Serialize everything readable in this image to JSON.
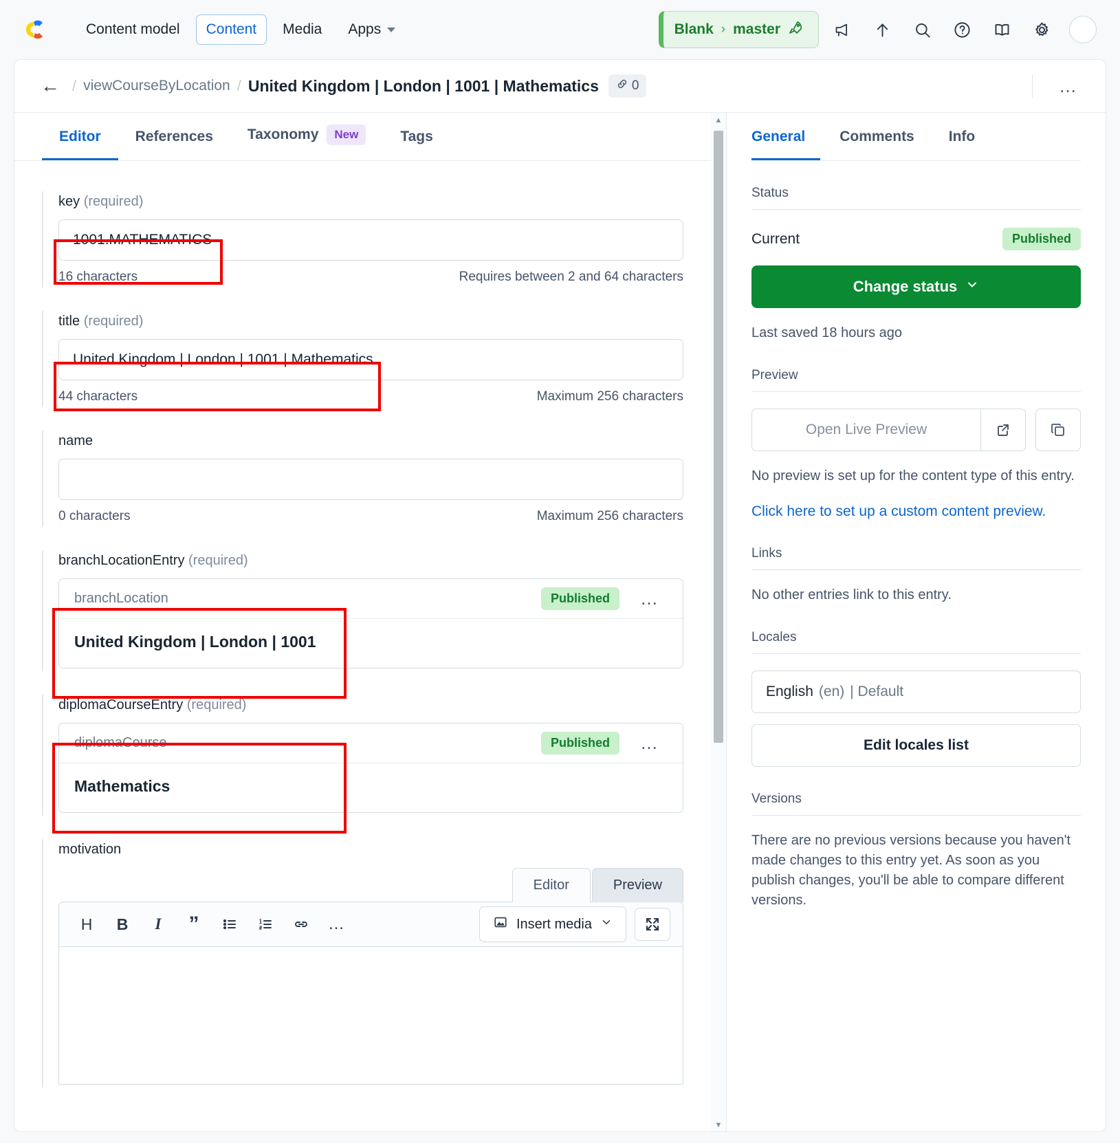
{
  "topnav": {
    "logo_icon": "contentful-logo",
    "items": [
      {
        "label": "Content model",
        "active": false,
        "caret": false
      },
      {
        "label": "Content",
        "active": true,
        "caret": false
      },
      {
        "label": "Media",
        "active": false,
        "caret": false
      },
      {
        "label": "Apps",
        "active": false,
        "caret": true
      }
    ],
    "environment": {
      "space": "Blank",
      "separator": "›",
      "env": "master",
      "icon": "rocket-icon"
    },
    "icons": [
      "megaphone-icon",
      "arrow-up-icon",
      "search-icon",
      "help-circle-icon",
      "book-icon",
      "gear-icon"
    ],
    "avatar": "user-avatar"
  },
  "breadcrumb": {
    "back_icon": "back-arrow-icon",
    "separator": "/",
    "parent": "viewCourseByLocation",
    "title": "United Kingdom | London | 1001 | Mathematics",
    "link_icon": "link-icon",
    "link_count": "0",
    "more_icon": "…"
  },
  "editor_tabs": [
    {
      "label": "Editor",
      "active": true,
      "badge": null
    },
    {
      "label": "References",
      "active": false,
      "badge": null
    },
    {
      "label": "Taxonomy",
      "active": false,
      "badge": "New"
    },
    {
      "label": "Tags",
      "active": false,
      "badge": null
    }
  ],
  "fields": {
    "key": {
      "label": "key",
      "required_text": "(required)",
      "value": "1001.MATHEMATICS",
      "count": "16 characters",
      "hint": "Requires between 2 and 64 characters"
    },
    "title": {
      "label": "title",
      "required_text": "(required)",
      "value": "United Kingdom | London | 1001 | Mathematics",
      "count": "44 characters",
      "hint": "Maximum 256 characters"
    },
    "name": {
      "label": "name",
      "required_text": "",
      "value": "",
      "count": "0 characters",
      "hint": "Maximum 256 characters"
    },
    "branchLocationEntry": {
      "label": "branchLocationEntry",
      "required_text": "(required)",
      "ref_type": "branchLocation",
      "status": "Published",
      "ref_title": "United Kingdom | London | 1001",
      "more_icon": "…"
    },
    "diplomaCourseEntry": {
      "label": "diplomaCourseEntry",
      "required_text": "(required)",
      "ref_type": "diplomaCourse",
      "status": "Published",
      "ref_title": "Mathematics",
      "more_icon": "…"
    },
    "motivation": {
      "label": "motivation",
      "mode_tabs": [
        {
          "label": "Editor",
          "active": false
        },
        {
          "label": "Preview",
          "active": true
        }
      ],
      "toolbar": [
        {
          "icon": "heading-icon",
          "glyph": "H"
        },
        {
          "icon": "bold-icon",
          "glyph": "B"
        },
        {
          "icon": "italic-icon",
          "glyph": "I"
        },
        {
          "icon": "quote-icon",
          "glyph": "”"
        },
        {
          "icon": "bullet-list-icon",
          "glyph": ""
        },
        {
          "icon": "numbered-list-icon",
          "glyph": ""
        },
        {
          "icon": "link-icon",
          "glyph": ""
        },
        {
          "icon": "more-options-icon",
          "glyph": "…"
        }
      ],
      "insert_media_label": "Insert media",
      "insert_media_icon": "image-icon",
      "expand_icon": "expand-icon",
      "content": ""
    }
  },
  "sidebar": {
    "tabs": [
      {
        "label": "General",
        "active": true
      },
      {
        "label": "Comments",
        "active": false
      },
      {
        "label": "Info",
        "active": false
      }
    ],
    "status": {
      "heading": "Status",
      "current_label": "Current",
      "current_value": "Published",
      "change_button": "Change status",
      "change_caret": "chevron-down-icon",
      "last_saved": "Last saved 18 hours ago"
    },
    "preview": {
      "heading": "Preview",
      "open_label": "Open Live Preview",
      "external_icon": "external-link-icon",
      "copy_icon": "copy-icon",
      "note": "No preview is set up for the content type of this entry.",
      "setup_link": "Click here to set up a custom content preview."
    },
    "links": {
      "heading": "Links",
      "note": "No other entries link to this entry."
    },
    "locales": {
      "heading": "Locales",
      "current": "English",
      "code": "(en)",
      "default_label": "| Default",
      "edit_button": "Edit locales list"
    },
    "versions": {
      "heading": "Versions",
      "note": "There are no previous versions because you haven't made changes to this entry yet. As soon as you publish changes, you'll be able to compare different versions."
    }
  },
  "colors": {
    "accent_blue": "#0d66d0",
    "publish_green": "#0a8a33",
    "badge_green_bg": "#c8f0cb",
    "badge_green_text": "#137d2e",
    "badge_new_bg": "#f0e6fb",
    "badge_new_text": "#7c3fce",
    "annotation_red": "#ef0000"
  }
}
